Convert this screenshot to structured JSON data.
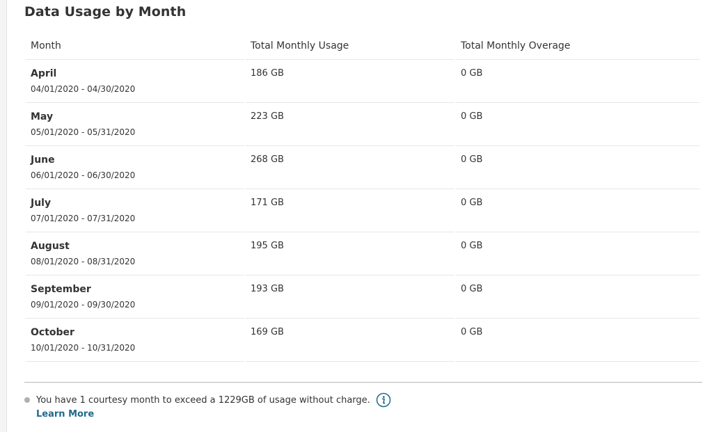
{
  "title": "Data Usage by Month",
  "table": {
    "headers": [
      "Month",
      "Total Monthly Usage",
      "Total Monthly Overage"
    ],
    "rows": [
      {
        "month": "April",
        "range": "04/01/2020 - 04/30/2020",
        "usage": "186 GB",
        "overage": "0 GB"
      },
      {
        "month": "May",
        "range": "05/01/2020 - 05/31/2020",
        "usage": "223 GB",
        "overage": "0 GB"
      },
      {
        "month": "June",
        "range": "06/01/2020 - 06/30/2020",
        "usage": "268 GB",
        "overage": "0 GB"
      },
      {
        "month": "July",
        "range": "07/01/2020 - 07/31/2020",
        "usage": "171 GB",
        "overage": "0 GB"
      },
      {
        "month": "August",
        "range": "08/01/2020 - 08/31/2020",
        "usage": "195 GB",
        "overage": "0 GB"
      },
      {
        "month": "September",
        "range": "09/01/2020 - 09/30/2020",
        "usage": "193 GB",
        "overage": "0 GB"
      },
      {
        "month": "October",
        "range": "10/01/2020 - 10/31/2020",
        "usage": "169 GB",
        "overage": "0 GB"
      }
    ]
  },
  "note": {
    "text": "You have 1 courtesy month to exceed a 1229GB of usage without charge.",
    "icon": "info-icon",
    "link_label": "Learn More"
  },
  "colors": {
    "link": "#1e6a8c",
    "bullet": "#b0b0b0",
    "divider": "#b8b8b8"
  }
}
